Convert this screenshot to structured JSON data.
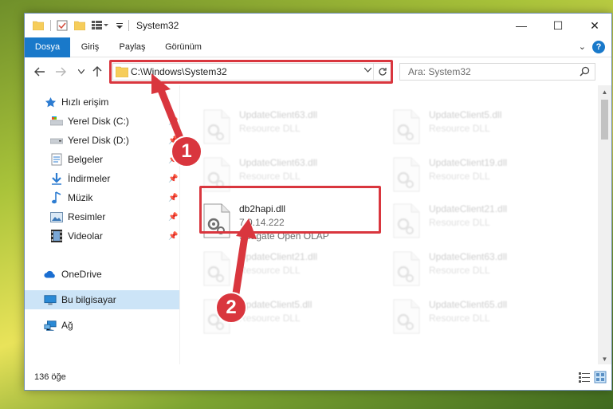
{
  "window": {
    "title": "System32",
    "minimize": "—",
    "maximize": "☐",
    "close": "✕"
  },
  "ribbon": {
    "tabs": [
      "Dosya",
      "Giriş",
      "Paylaş",
      "Görünüm"
    ],
    "help": "?"
  },
  "navigation": {
    "address": "C:\\Windows\\System32",
    "search_placeholder": "Ara: System32"
  },
  "sidebar": {
    "items": [
      {
        "label": "Hızlı erişim",
        "icon": "star-icon"
      },
      {
        "label": "Yerel Disk (C:)",
        "icon": "drive-icon",
        "pinned": true
      },
      {
        "label": "Yerel Disk (D:)",
        "icon": "drive-icon",
        "pinned": true
      },
      {
        "label": "Belgeler",
        "icon": "documents-icon",
        "pinned": true
      },
      {
        "label": "İndirmeler",
        "icon": "download-icon",
        "pinned": true
      },
      {
        "label": "Müzik",
        "icon": "music-icon",
        "pinned": true
      },
      {
        "label": "Resimler",
        "icon": "pictures-icon",
        "pinned": true
      },
      {
        "label": "Videolar",
        "icon": "videos-icon",
        "pinned": true
      },
      {
        "label": "OneDrive",
        "icon": "cloud-icon"
      },
      {
        "label": "Bu bilgisayar",
        "icon": "computer-icon",
        "selected": true
      },
      {
        "label": "Ağ",
        "icon": "network-icon"
      }
    ]
  },
  "files": {
    "left_column": [
      {
        "name": "UpdateClient63.dll",
        "desc": "Resource DLL"
      },
      {
        "name": "UpdateClient63.dll",
        "desc": "Resource DLL"
      },
      {
        "name": "db2hapi.dll",
        "desc": "7.0.14.222",
        "vendor": "Seagate Open OLAP"
      },
      {
        "name": "UpdateClient21.dll",
        "desc": "Resource DLL"
      },
      {
        "name": "UpdateClient5.dll",
        "desc": "Resource DLL"
      }
    ],
    "right_column": [
      {
        "name": "UpdateClient5.dll",
        "desc": "Resource DLL"
      },
      {
        "name": "UpdateClient19.dll",
        "desc": "Resource DLL"
      },
      {
        "name": "UpdateClient21.dll",
        "desc": "Resource DLL"
      },
      {
        "name": "UpdateClient63.dll",
        "desc": "Resource DLL"
      },
      {
        "name": "UpdateClient65.dll",
        "desc": "Resource DLL"
      }
    ]
  },
  "status": {
    "count": "136 öğe"
  },
  "callouts": [
    "1",
    "2"
  ],
  "colors": {
    "accent": "#1979ca",
    "highlight": "#d9363e",
    "selected": "#cce4f7"
  }
}
